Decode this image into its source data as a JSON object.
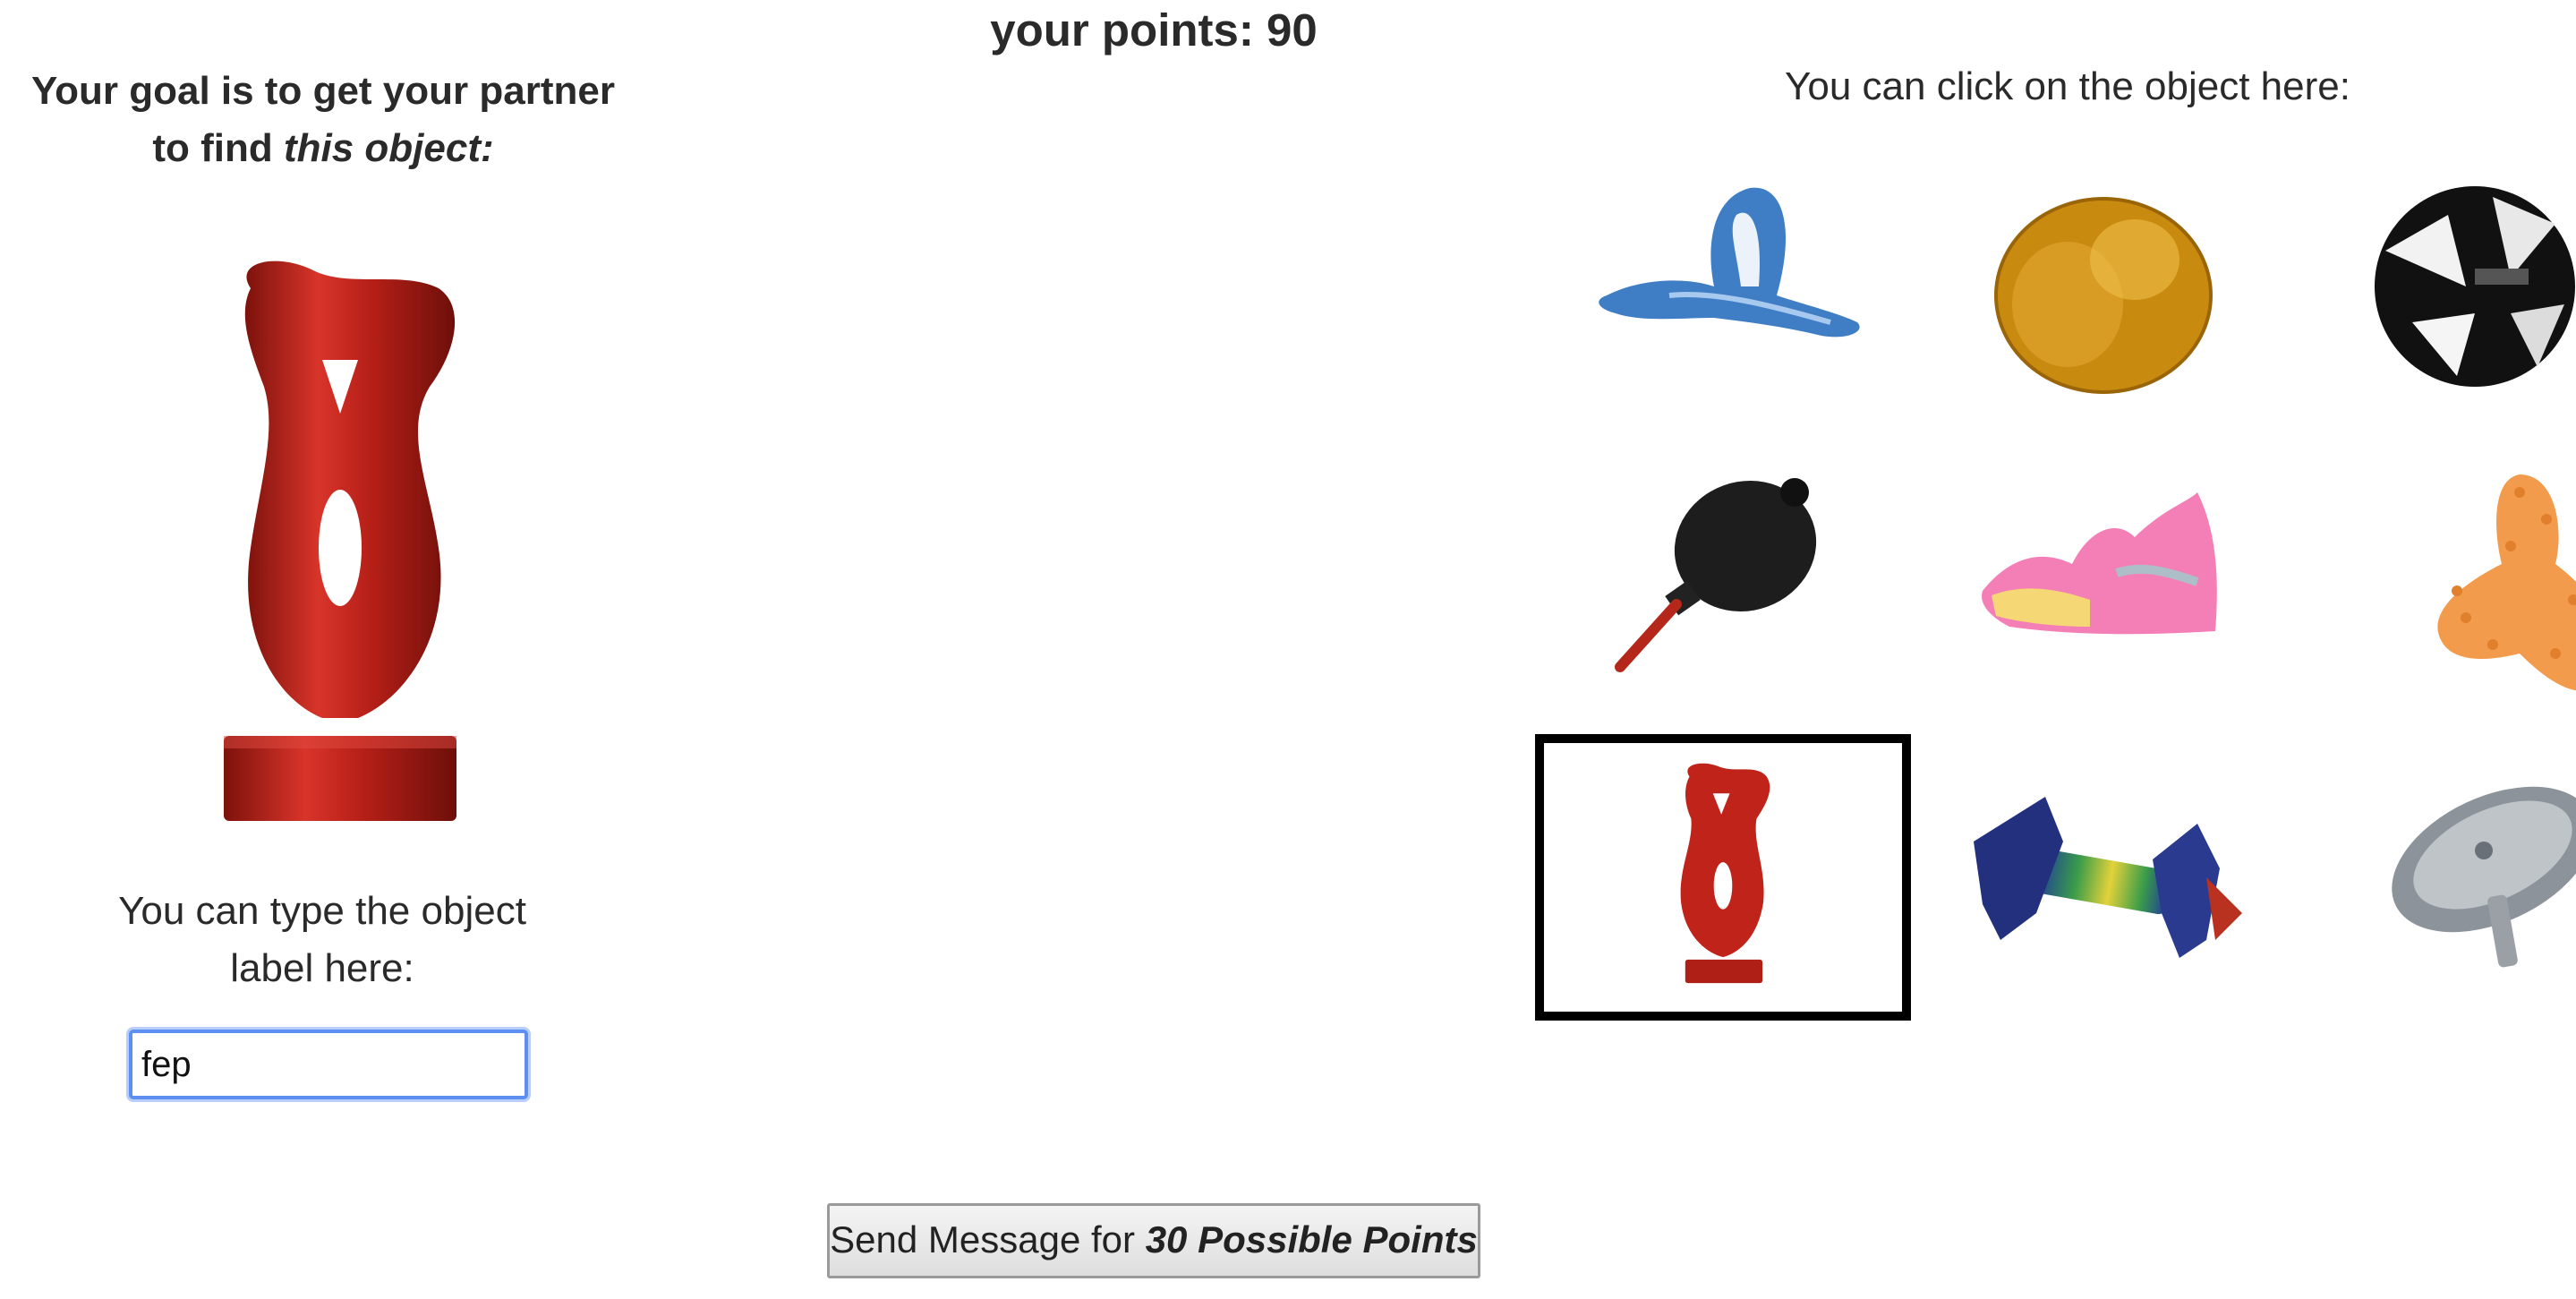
{
  "header": {
    "points_label": "your points: 90"
  },
  "goal": {
    "line1": "Your goal is to get your partner",
    "line2_prefix": "to find ",
    "line2_emph": "this object:"
  },
  "label_entry": {
    "prompt_line1": "You can type the object",
    "prompt_line2": "label here:",
    "value": "fep"
  },
  "choices": {
    "prompt": "You can click on the object here:",
    "items": [
      {
        "name": "blue-ribbon-object",
        "selected": false
      },
      {
        "name": "amber-bulb-object",
        "selected": false
      },
      {
        "name": "black-white-ball-object",
        "selected": false
      },
      {
        "name": "black-air-blower-object",
        "selected": false
      },
      {
        "name": "pink-wing-object",
        "selected": false
      },
      {
        "name": "orange-spiky-object",
        "selected": true
      },
      {
        "name": "red-vase-sculpture-object",
        "selected": true
      },
      {
        "name": "blue-rainbow-connector-object",
        "selected": false
      },
      {
        "name": "silver-disc-object",
        "selected": false
      }
    ]
  },
  "send_button": {
    "prefix": "Send Message for ",
    "emph": "30 Possible Points"
  },
  "colors": {
    "input_focus": "#5d8ff0",
    "selected_border": "#000000",
    "vase_red": "#c0231a"
  }
}
